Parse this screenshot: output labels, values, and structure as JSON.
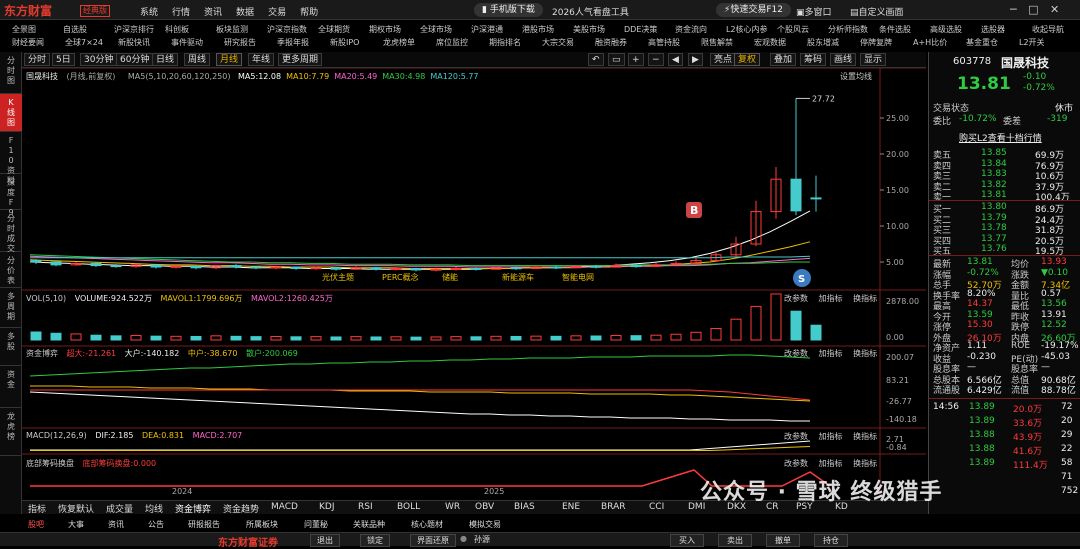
{
  "app": {
    "logo": "东方财富",
    "edition": "经典版"
  },
  "menu": [
    "系统",
    "行情",
    "资讯",
    "数据",
    "交易",
    "帮助"
  ],
  "top_pills": {
    "download": "手机版下载",
    "promo": "2026人气看盘工具",
    "quick_trade": "快速交易F12",
    "multi_window": "多窗口",
    "custom_screen": "自定义画面"
  },
  "nav_row1": [
    "全景图",
    "自选股",
    "沪深京排行",
    "科创板",
    "板块监测",
    "沪深京指数",
    "全球期货",
    "期权市场",
    "全球市场",
    "沪深港通",
    "港股市场",
    "美股市场",
    "DDE决策",
    "资金流向",
    "L2核心内参",
    "个股风云",
    "分析师指数",
    "条件选股",
    "高级选股",
    "选股器",
    "收起导航"
  ],
  "nav_row2": [
    "财经要闻",
    "全球7×24",
    "新股快讯",
    "事件驱动",
    "研究报告",
    "季报年报",
    "新股IPO",
    "龙虎榜单",
    "席位监控",
    "期指排名",
    "大宗交易",
    "融资融券",
    "高管持股",
    "限售解禁",
    "宏观数据",
    "股东增减",
    "停牌复牌",
    "A+H比价",
    "基金重仓",
    "L2开关"
  ],
  "toolbar": {
    "items": [
      "分时",
      "5日",
      "30分钟",
      "60分钟",
      "日线",
      "周线",
      "月线",
      "年线",
      "更多周期"
    ],
    "active": "月线",
    "right_items": [
      "亮点",
      "复权",
      "叠加",
      "筹码",
      "画线",
      "显示",
      "设置均线"
    ]
  },
  "left_tabs": [
    "分时图",
    "K线图",
    "F10资料",
    "深度F9",
    "分时成交",
    "分价表",
    "多周期",
    "多股",
    "资金",
    "龙虎榜"
  ],
  "main_chart": {
    "stock": "国晟科技",
    "period": "(月线,前复权)",
    "ma_label": "MA5(5,10,20,60,120,250)",
    "ma_values": [
      {
        "name": "MA5",
        "value": "12.08",
        "color": "#ffffff"
      },
      {
        "name": "MA10",
        "value": "7.79",
        "color": "#f0c000"
      },
      {
        "name": "MA20",
        "value": "5.49",
        "color": "#ff66cc"
      },
      {
        "name": "MA30",
        "value": "4.98",
        "color": "#2ecc40"
      },
      {
        "name": "MA120",
        "value": "5.77",
        "color": "#4cc"
      }
    ],
    "y_ticks": [
      "25.00",
      "20.00",
      "15.00",
      "10.00",
      "5.00"
    ],
    "high_label": "27.72",
    "marker_b": "B",
    "marker_s": "S",
    "annotations": [
      "光伏主题",
      "PERC概念",
      "储能",
      "新能源车",
      "智能电网"
    ]
  },
  "vol_panel": {
    "label": "VOL(5,10)",
    "volume": "VOLUME:924.522万",
    "mavol1": "MAVOL1:1799.696万",
    "mavol2": "MAVOL2:1260.425万",
    "y_ticks": [
      "2878.00",
      "0.00"
    ],
    "buttons": [
      "改参数",
      "加指标",
      "换指标"
    ]
  },
  "fund_panel": {
    "label": "资金博弈",
    "super": "超大:-21.261",
    "large": "大户:-140.182",
    "mid": "中户:-38.670",
    "small": "散户:200.069",
    "y_ticks": [
      "200.07",
      "83.21",
      "-26.77",
      "-140.18"
    ],
    "buttons": [
      "改参数",
      "加指标",
      "换指标"
    ]
  },
  "macd_panel": {
    "label": "MACD(12,26,9)",
    "dif": "DIF:2.185",
    "dea": "DEA:0.831",
    "macd": "MACD:2.707",
    "y_ticks": [
      "2.71",
      "-0.84"
    ],
    "buttons": [
      "改参数",
      "加指标",
      "换指标"
    ]
  },
  "cost_panel": {
    "label": "底部筹码换盘",
    "value": "底部筹码换盘:0.000",
    "buttons": [
      "改参数",
      "加指标",
      "换指标"
    ]
  },
  "x_axis": [
    "2024",
    "2025"
  ],
  "indicator_tabs": [
    "指标",
    "恢复默认",
    "成交量",
    "均线",
    "资金博弈",
    "资金趋势",
    "MACD",
    "KDJ",
    "RSI",
    "BOLL",
    "WR",
    "OBV",
    "BIAS",
    "ENE",
    "BRAR",
    "CCI",
    "DMI",
    "DKX",
    "CR",
    "PSY",
    "KD"
  ],
  "bottom_tabs": [
    "股吧",
    "大事",
    "资讯",
    "公告",
    "研报报告",
    "所属板块",
    "问董秘",
    "关联品种",
    "核心题材",
    "模拟交易"
  ],
  "quote": {
    "code": "603778",
    "name": "国晟科技",
    "price": "13.81",
    "change": "-0.10",
    "pct": "-0.72%",
    "trade_status_label": "交易状态",
    "trade_status": "休市",
    "weibi_label": "委比",
    "weibi": "-10.72%",
    "weicha_label": "委差",
    "weicha": "-319",
    "l2_link": "购买L2查看十档行情",
    "asks": [
      {
        "label": "卖五",
        "price": "13.85",
        "vol": "69.9万"
      },
      {
        "label": "卖四",
        "price": "13.84",
        "vol": "76.9万"
      },
      {
        "label": "卖三",
        "price": "13.83",
        "vol": "10.6万"
      },
      {
        "label": "卖二",
        "price": "13.82",
        "vol": "37.9万"
      },
      {
        "label": "卖一",
        "price": "13.81",
        "vol": "100.4万"
      }
    ],
    "bids": [
      {
        "label": "买一",
        "price": "13.80",
        "vol": "86.9万"
      },
      {
        "label": "买二",
        "price": "13.79",
        "vol": "24.4万"
      },
      {
        "label": "买三",
        "price": "13.78",
        "vol": "31.8万"
      },
      {
        "label": "买四",
        "price": "13.77",
        "vol": "20.5万"
      },
      {
        "label": "买五",
        "price": "13.76",
        "vol": "19.5万"
      }
    ],
    "stats": [
      {
        "l1": "最新",
        "v1": "13.81",
        "c1": "green",
        "l2": "均价",
        "v2": "13.93",
        "c2": "red"
      },
      {
        "l1": "涨幅",
        "v1": "-0.72%",
        "c1": "green",
        "l2": "涨跌",
        "v2": "▼0.10",
        "c2": "green"
      },
      {
        "l1": "总手",
        "v1": "52.70万",
        "c1": "yellow",
        "l2": "金额",
        "v2": "7.34亿",
        "c2": "yellow"
      },
      {
        "l1": "换手率",
        "v1": "8.20%",
        "c1": "white",
        "l2": "量比",
        "v2": "0.57",
        "c2": "white"
      },
      {
        "l1": "最高",
        "v1": "14.37",
        "c1": "red",
        "l2": "最低",
        "v2": "13.56",
        "c2": "green"
      },
      {
        "l1": "今开",
        "v1": "13.59",
        "c1": "green",
        "l2": "昨收",
        "v2": "13.91",
        "c2": "white"
      },
      {
        "l1": "涨停",
        "v1": "15.30",
        "c1": "red",
        "l2": "跌停",
        "v2": "12.52",
        "c2": "green"
      },
      {
        "l1": "外盘",
        "v1": "26.10万",
        "c1": "red",
        "l2": "内盘",
        "v2": "26.60万",
        "c2": "green"
      },
      {
        "l1": "净资产",
        "v1": "1.11",
        "c1": "white",
        "l2": "ROE",
        "v2": "-19.17%",
        "c2": "white"
      },
      {
        "l1": "收益",
        "v1": "-0.230",
        "c1": "white",
        "l2": "PE(动)",
        "v2": "-45.03",
        "c2": "white"
      },
      {
        "l1": "股息率",
        "v1": "—",
        "c1": "white",
        "l2": "股息率",
        "v2": "—",
        "c2": "white"
      },
      {
        "l1": "总股本",
        "v1": "6.566亿",
        "c1": "white",
        "l2": "总值",
        "v2": "90.68亿",
        "c2": "white"
      },
      {
        "l1": "流通股",
        "v1": "6.429亿",
        "c1": "white",
        "l2": "流值",
        "v2": "88.78亿",
        "c2": "white"
      }
    ],
    "ticks": [
      {
        "t": "14:56",
        "p": "13.89",
        "v": "20.0万",
        "n": "72"
      },
      {
        "t": "",
        "p": "13.89",
        "v": "33.6万",
        "n": "20"
      },
      {
        "t": "",
        "p": "13.88",
        "v": "43.9万",
        "n": "29"
      },
      {
        "t": "",
        "p": "13.88",
        "v": "41.6万",
        "n": "22"
      },
      {
        "t": "",
        "p": "13.89",
        "v": "111.4万",
        "n": "58"
      },
      {
        "t": "",
        "p": "",
        "v": "",
        "n": "71"
      },
      {
        "t": "",
        "p": "",
        "v": "",
        "n": "752"
      }
    ]
  },
  "status_bar": {
    "brand": "东方财富证券",
    "buttons": [
      "退出",
      "锁定",
      "界面还原"
    ],
    "account": "孙源",
    "trade_buttons": [
      "买入",
      "卖出",
      "撤单",
      "持仓"
    ]
  },
  "watermark": "公众号 · 雪球 终级猎手"
}
